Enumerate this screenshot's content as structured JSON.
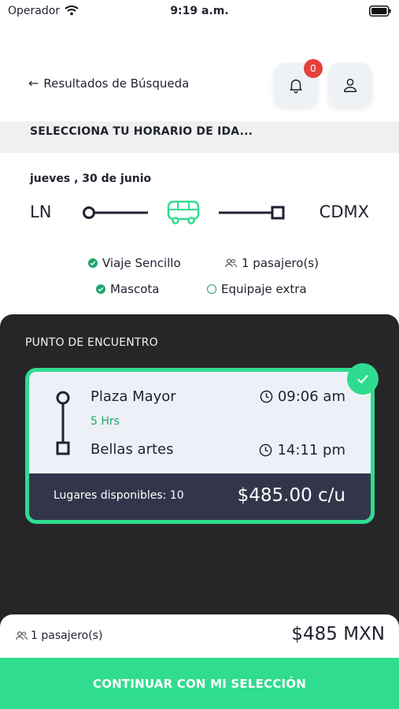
{
  "status_bar": {
    "carrier": "Operador",
    "time": "9:19 a.m."
  },
  "header": {
    "back_label": "Resultados de Búsqueda",
    "notifications_count": "0",
    "icons": {
      "back": "arrow-left-icon",
      "notifications": "bell-icon",
      "profile": "user-icon"
    }
  },
  "section_title": "SELECCIONA TU HORARIO DE IDA...",
  "trip": {
    "date": "jueves , 30 de junio",
    "origin_code": "LN",
    "destination_code": "CDMX",
    "vehicle_icon": "bus-icon"
  },
  "options": [
    {
      "label": "Viaje Sencillo",
      "selected": true
    },
    {
      "label": "1 pasajero(s)",
      "icon": "people-icon"
    },
    {
      "label": "Mascota",
      "selected": true
    },
    {
      "label": "Equipaje extra",
      "selected": false
    }
  ],
  "meeting_point": {
    "title": "PUNTO DE ENCUENTRO",
    "card": {
      "origin": "Plaza Mayor",
      "departure_time": "09:06 am",
      "duration": "5 Hrs",
      "destination": "Bellas artes",
      "arrival_time": "14:11 pm",
      "seats_label": "Lugares disponibles: 10",
      "price": "$485.00 c/u",
      "selected": true
    }
  },
  "summary": {
    "passengers": "1 pasajero(s)",
    "total": "$485 MXN"
  },
  "cta_label": "CONTINUAR CON MI SELECCIÓN",
  "colors": {
    "accent": "#30dc8e",
    "success": "#1ea66b",
    "dark": "#262628",
    "card_footer": "#33364b",
    "badge": "#e5403b"
  }
}
